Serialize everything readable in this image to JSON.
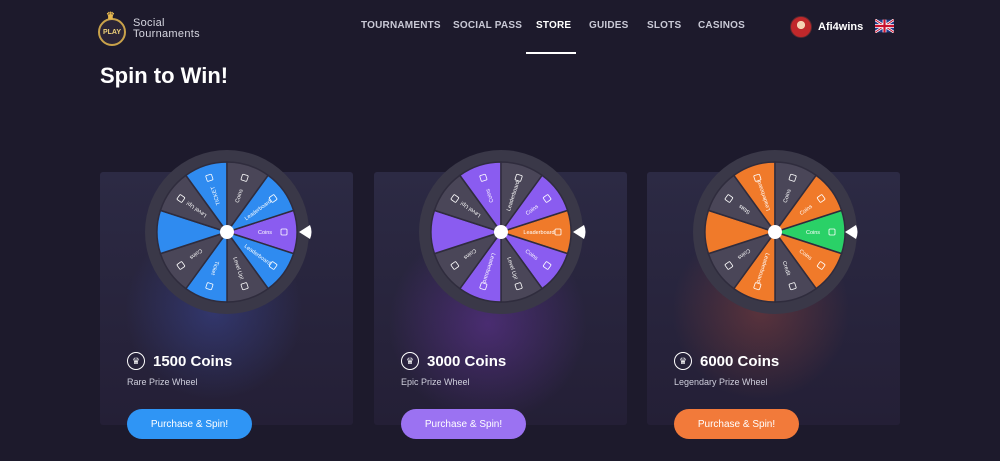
{
  "header": {
    "logo_badge": "PLAY",
    "logo_line1": "Social",
    "logo_line2": "Tournaments",
    "nav": [
      "TOURNAMENTS",
      "SOCIAL PASS",
      "STORE",
      "GUIDES",
      "SLOTS",
      "CASINOS"
    ],
    "active_nav": "STORE",
    "username": "Afi4wins",
    "language_icon": "uk-flag-icon"
  },
  "page": {
    "title": "Spin to Win!"
  },
  "wheels": [
    {
      "price": "1500 Coins",
      "name": "Rare Prize Wheel",
      "button": "Purchase & Spin!",
      "accent": "#2f8bf0",
      "highlight": "#8a5cf0",
      "button_color": "#2f95f5",
      "segments": [
        "Coins",
        "Leaderboard",
        "Level Up!",
        "Ticket",
        "Coins",
        "",
        "Level Up!",
        "TICKET",
        "Coins",
        "Leaderboard"
      ]
    },
    {
      "price": "3000 Coins",
      "name": "Epic Prize Wheel",
      "button": "Purchase & Spin!",
      "accent": "#8a5cf0",
      "highlight": "#f07a2a",
      "button_color": "#9b72f2",
      "segments": [
        "Leaderboard",
        "Coins",
        "Level Up!",
        "Leaderboard",
        "Coins",
        "",
        "Level Up!",
        "Coins",
        "Leaderboard",
        "Coins"
      ]
    },
    {
      "price": "6000 Coins",
      "name": "Legendary Prize Wheel",
      "button": "Purchase & Spin!",
      "accent": "#f07a2a",
      "highlight": "#2ad167",
      "button_color": "#f27a3a",
      "segments": [
        "Coins",
        "Coins",
        "Credit",
        "Leaderboard",
        "Coins",
        "",
        "Stats",
        "Leaderboard",
        "Coins",
        "Coins"
      ]
    }
  ]
}
